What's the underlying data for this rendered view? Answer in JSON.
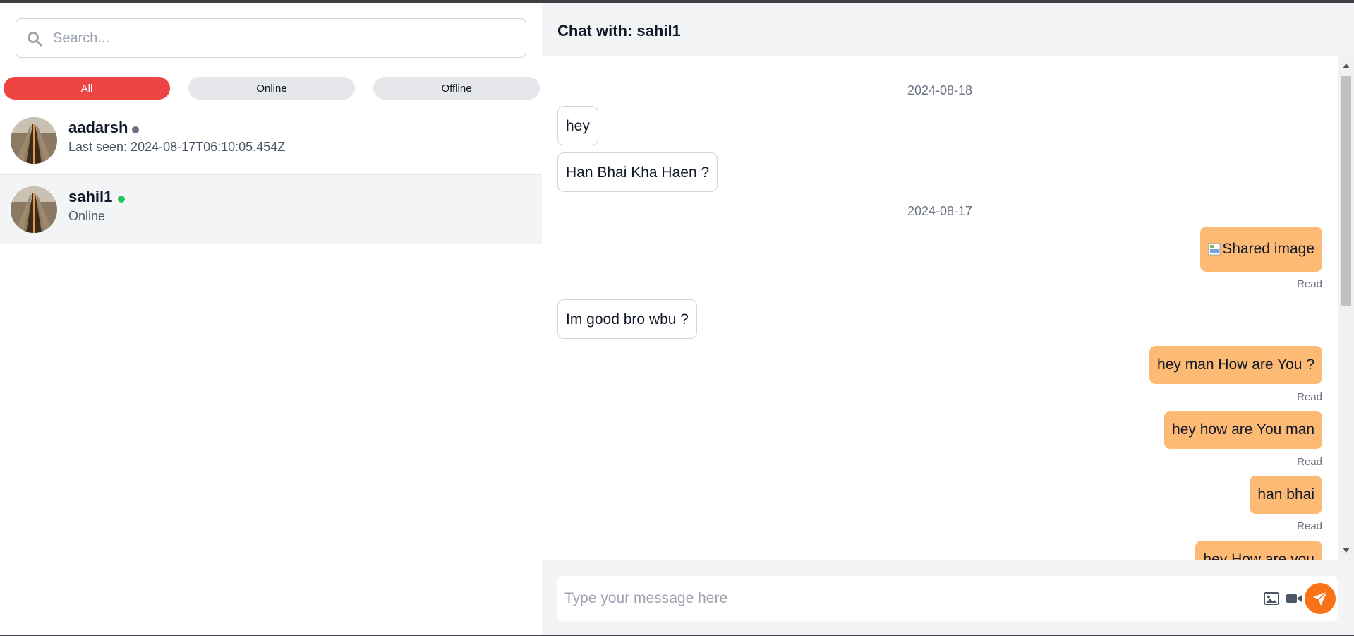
{
  "search": {
    "placeholder": "Search..."
  },
  "filters": [
    {
      "label": "All",
      "active": true
    },
    {
      "label": "Online",
      "active": false
    },
    {
      "label": "Offline",
      "active": false
    }
  ],
  "contacts": [
    {
      "name": "aadarsh",
      "status": "offline",
      "status_color": "#6b7280",
      "subtitle": "Last seen: 2024-08-17T06:10:05.454Z",
      "selected": false
    },
    {
      "name": "sahil1",
      "status": "online",
      "status_color": "#22c55e",
      "subtitle": "Online",
      "selected": true
    }
  ],
  "chat": {
    "title": "Chat with: sahil1",
    "dates": [
      "2024-08-18",
      "2024-08-17"
    ],
    "messages": [
      {
        "text": "hey",
        "direction": "incoming"
      },
      {
        "text": "Han Bhai Kha Haen ?",
        "direction": "incoming"
      },
      {
        "text": "Shared image",
        "direction": "outgoing",
        "status": "Read",
        "image": true
      },
      {
        "text": "Im good bro wbu ?",
        "direction": "incoming"
      },
      {
        "text": "hey man How are You ?",
        "direction": "outgoing",
        "status": "Read"
      },
      {
        "text": "hey how are You man",
        "direction": "outgoing",
        "status": "Read"
      },
      {
        "text": "han bhai",
        "direction": "outgoing",
        "status": "Read"
      },
      {
        "text": "hey How are you",
        "direction": "outgoing"
      }
    ],
    "composer": {
      "placeholder": "Type your message here"
    }
  },
  "icons": {
    "search": "search-icon",
    "image": "image-icon",
    "video": "video-icon",
    "send": "send-icon"
  },
  "colors": {
    "accent": "#f97316",
    "active_filter": "#ef4444",
    "outgoing_bubble": "#fdba74",
    "online": "#22c55e",
    "offline": "#6b7280"
  }
}
